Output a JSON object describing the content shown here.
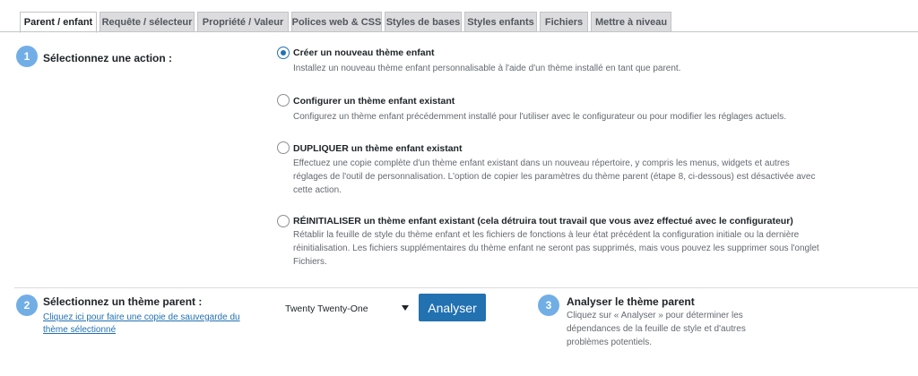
{
  "tabs": [
    {
      "label": "Parent / enfant",
      "active": true
    },
    {
      "label": "Requête / sélecteur",
      "active": false
    },
    {
      "label": "Propriété / Valeur",
      "active": false
    },
    {
      "label": "Polices web & CSS",
      "active": false
    },
    {
      "label": "Styles de bases",
      "active": false
    },
    {
      "label": "Styles enfants",
      "active": false
    },
    {
      "label": "Fichiers",
      "active": false
    },
    {
      "label": "Mettre à niveau",
      "active": false
    }
  ],
  "step1": {
    "number": "1",
    "title": "Sélectionnez une action :",
    "options": [
      {
        "label": "Créer un nouveau thème enfant",
        "description": "Installez un nouveau thème enfant personnalisable à l'aide d'un thème installé en tant que parent.",
        "checked": true
      },
      {
        "label": "Configurer un thème enfant existant",
        "description": "Configurez un thème enfant précédemment installé pour l'utiliser avec le configurateur ou pour modifier les réglages actuels.",
        "checked": false
      },
      {
        "label": "DUPLIQUER un thème enfant existant",
        "description": "Effectuez une copie complète d'un thème enfant existant dans un nouveau répertoire, y compris les menus, widgets et autres réglages de l'outil de personnalisation. L'option de copier les paramètres du thème parent (étape 8, ci-dessous) est désactivée avec cette action.",
        "checked": false
      },
      {
        "label": "RÉINITIALISER un thème enfant existant (cela détruira tout travail que vous avez effectué avec le configurateur)",
        "description": "Rétablir la feuille de style du thème enfant et les fichiers de fonctions à leur état précédent la configuration initiale ou la dernière réinitialisation. Les fichiers supplémentaires du thème enfant ne seront pas supprimés, mais vous pouvez les supprimer sous l'onglet Fichiers.",
        "checked": false
      }
    ]
  },
  "step2": {
    "number": "2",
    "title": "Sélectionnez un thème parent :",
    "backup_link": "Cliquez ici pour faire une copie de sauvegarde du thème sélectionné",
    "selected_theme": "Twenty Twenty-One",
    "analyze_button": "Analyser"
  },
  "step3": {
    "number": "3",
    "title": "Analyser le thème parent",
    "description": "Cliquez sur « Analyser » pour déterminer les dépendances de la feuille de style et d'autres problèmes potentiels."
  },
  "colors": {
    "accent": "#2271b1",
    "badge": "#72aee6"
  }
}
